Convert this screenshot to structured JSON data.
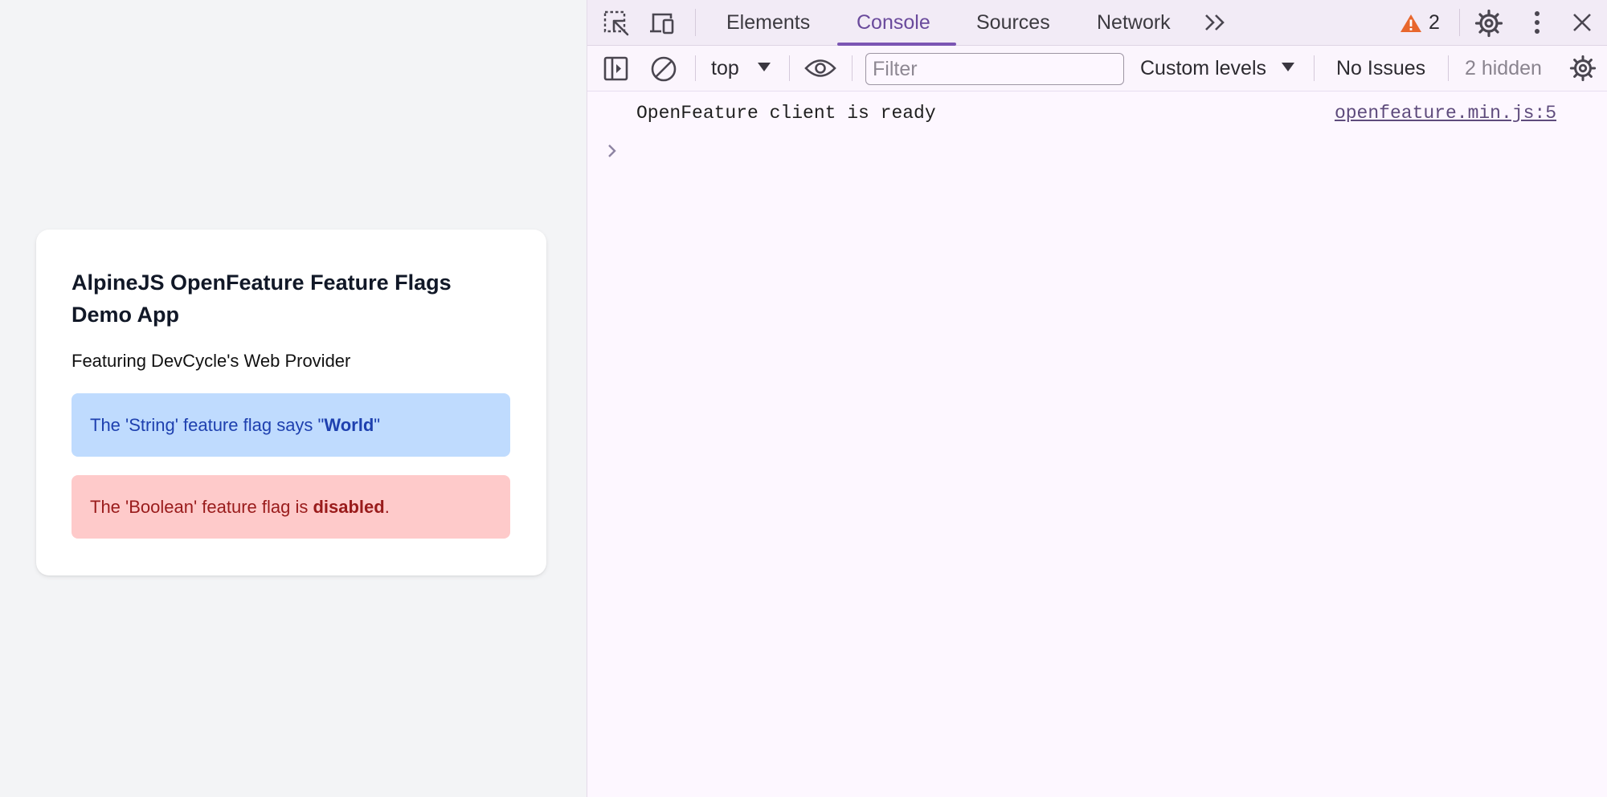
{
  "page": {
    "title": "AlpineJS OpenFeature Feature Flags Demo App",
    "subtitle": "Featuring DevCycle's Web Provider",
    "string_flag": {
      "prefix": "The 'String' feature flag says \"",
      "value": "World",
      "suffix": "\""
    },
    "boolean_flag": {
      "prefix": "The 'Boolean' feature flag is ",
      "value": "disabled",
      "suffix": "."
    }
  },
  "devtools": {
    "tabs": [
      {
        "label": "Elements"
      },
      {
        "label": "Console",
        "active": true
      },
      {
        "label": "Sources"
      },
      {
        "label": "Network"
      }
    ],
    "warning_count": "2",
    "toolbar": {
      "context": "top",
      "filter_placeholder": "Filter",
      "levels": "Custom levels",
      "issues": "No Issues",
      "hidden": "2 hidden"
    },
    "console": {
      "message": "OpenFeature client is ready",
      "source": "openfeature.min.js:5"
    },
    "icons": [
      "inspect-element-icon",
      "device-toolbar-icon",
      "more-tabs-icon",
      "warning-icon",
      "settings-icon",
      "more-options-icon",
      "close-icon",
      "sidebar-toggle-icon",
      "clear-console-icon",
      "dropdown-caret-icon",
      "eye-icon",
      "chevron-right-icon"
    ],
    "colors": {
      "accent": "#7b55b3",
      "warning": "#e8672d"
    }
  }
}
